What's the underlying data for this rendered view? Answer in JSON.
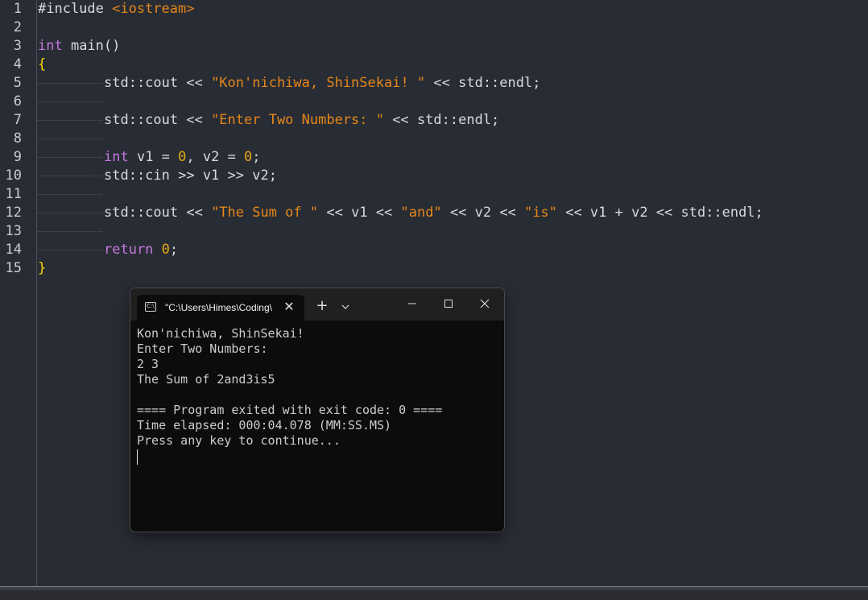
{
  "editor": {
    "line_numbers": [
      "1",
      "2",
      "3",
      "4",
      "5",
      "6",
      "7",
      "8",
      "9",
      "10",
      "11",
      "12",
      "13",
      "14",
      "15"
    ],
    "lines": [
      {
        "n": 1,
        "indent": false,
        "tokens": [
          {
            "t": "#include ",
            "c": "def"
          },
          {
            "t": "<iostream>",
            "c": "str"
          }
        ]
      },
      {
        "n": 2,
        "indent": false,
        "tokens": []
      },
      {
        "n": 3,
        "indent": false,
        "tokens": [
          {
            "t": "int",
            "c": "kw"
          },
          {
            "t": " main()",
            "c": "def"
          }
        ]
      },
      {
        "n": 4,
        "indent": false,
        "tokens": [
          {
            "t": "{",
            "c": "brace"
          }
        ]
      },
      {
        "n": 5,
        "indent": true,
        "tokens": [
          {
            "t": "std::cout << ",
            "c": "def"
          },
          {
            "t": "\"Kon'nichiwa, ShinSekai! \"",
            "c": "str"
          },
          {
            "t": " << std::endl;",
            "c": "def"
          }
        ]
      },
      {
        "n": 6,
        "indent": true,
        "tokens": []
      },
      {
        "n": 7,
        "indent": true,
        "tokens": [
          {
            "t": "std::cout << ",
            "c": "def"
          },
          {
            "t": "\"Enter Two Numbers: \"",
            "c": "str"
          },
          {
            "t": " << std::endl;",
            "c": "def"
          }
        ]
      },
      {
        "n": 8,
        "indent": true,
        "tokens": []
      },
      {
        "n": 9,
        "indent": true,
        "tokens": [
          {
            "t": "int",
            "c": "kw"
          },
          {
            "t": " v1 = ",
            "c": "def"
          },
          {
            "t": "0",
            "c": "num"
          },
          {
            "t": ", v2 = ",
            "c": "def"
          },
          {
            "t": "0",
            "c": "num"
          },
          {
            "t": ";",
            "c": "def"
          }
        ]
      },
      {
        "n": 10,
        "indent": true,
        "tokens": [
          {
            "t": "std::cin >> v1 >> v2;",
            "c": "def"
          }
        ]
      },
      {
        "n": 11,
        "indent": true,
        "tokens": []
      },
      {
        "n": 12,
        "indent": true,
        "tokens": [
          {
            "t": "std::cout << ",
            "c": "def"
          },
          {
            "t": "\"The Sum of \"",
            "c": "str"
          },
          {
            "t": " << v1 << ",
            "c": "def"
          },
          {
            "t": "\"and\"",
            "c": "str"
          },
          {
            "t": " << v2 << ",
            "c": "def"
          },
          {
            "t": "\"is\"",
            "c": "str"
          },
          {
            "t": " << v1 + v2 << std::endl;",
            "c": "def"
          }
        ]
      },
      {
        "n": 13,
        "indent": true,
        "tokens": []
      },
      {
        "n": 14,
        "indent": true,
        "tokens": [
          {
            "t": "return",
            "c": "kw"
          },
          {
            "t": " ",
            "c": "def"
          },
          {
            "t": "0",
            "c": "num"
          },
          {
            "t": ";",
            "c": "def"
          }
        ]
      },
      {
        "n": 15,
        "indent": false,
        "tokens": [
          {
            "t": "}",
            "c": "brace"
          }
        ]
      }
    ]
  },
  "terminal": {
    "tab_title": "\"C:\\Users\\Himes\\Coding\\",
    "tab_icon": "terminal-icon",
    "tab_close_label": "✕",
    "new_tab_label": "+",
    "output_lines": [
      "Kon'nichiwa, ShinSekai!",
      "Enter Two Numbers:",
      "2 3",
      "The Sum of 2and3is5",
      "",
      "==== Program exited with exit code: 0 ====",
      "Time elapsed: 000:04.078 (MM:SS.MS)",
      "Press any key to continue..."
    ]
  }
}
